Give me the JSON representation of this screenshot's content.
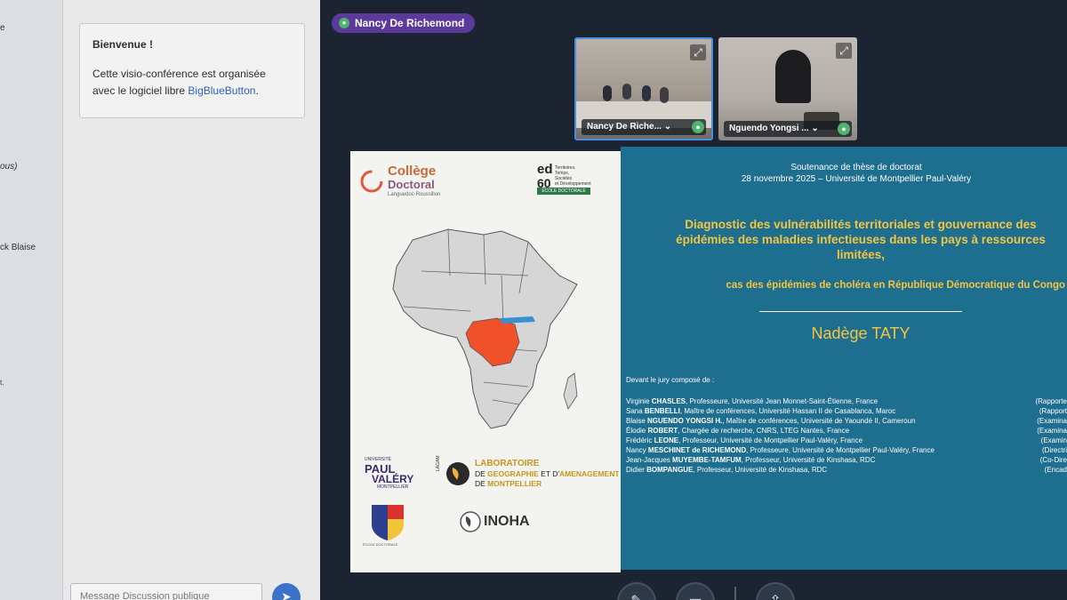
{
  "users": {
    "fragments": [
      "e",
      "ous)",
      "ck Blaise",
      "t."
    ]
  },
  "chat": {
    "welcome_title": "Bienvenue !",
    "welcome_line1": "Cette visio-conférence est organisée",
    "welcome_line2": "avec le logiciel libre",
    "welcome_link": "BigBlueButton",
    "welcome_end": ".",
    "message_placeholder": "Message Discussion publique",
    "send_icon": "send-icon"
  },
  "presenter": {
    "name": "Nancy De Richemond"
  },
  "videos": [
    {
      "name": "Nancy De Riche...",
      "chevron": "⌄"
    },
    {
      "name": "Nguendo Yongsi ...",
      "chevron": "⌄"
    }
  ],
  "slide": {
    "college_line1": "Collège",
    "college_line2": "Doctoral",
    "college_sub": "Languedoc-Roussillon",
    "ed_mark": "ed",
    "ed_num": "60",
    "ed_desc1": "Territoires,",
    "ed_desc2": "Temps,",
    "ed_desc3": "Sociétés",
    "ed_desc4": "et Développement",
    "ed_school": "ÉCOLE DOCTORALE",
    "upv_line1": "PAUL",
    "upv_line2": "VALÉRY",
    "upv_small": "UNIVERSITÉ",
    "upv_bottom": "MONTPELLIER",
    "lab_line1": "LABORATOIRE",
    "lab_line2a": "DE ",
    "lab_line2b": "GEOGRAPHIE",
    "lab_line2c": " ET D'",
    "lab_line2d": "AMENAGEMENT",
    "lab_line3a": "DE ",
    "lab_line3b": "MONTPELLIER",
    "lab_side": "LAGAM",
    "inoha": "INOHA",
    "shield_caption": "ÉCOLE DOCTORALE",
    "header1": "Soutenance de thèse de doctorat",
    "header2": "28 novembre 2025 – Université de Montpellier Paul-Valéry",
    "title1": "Diagnostic des vulnérabilités territoriales et gouvernance des",
    "title2": "épidémies des maladies infectieuses dans les pays à ressources",
    "title3": "limitées,",
    "subtitle": "cas des épidémies de choléra en République Démocratique du Congo",
    "author": "Nadège TATY",
    "jury_intro": "Devant le jury composé de :",
    "jury": [
      {
        "first": "Virginie ",
        "last": "CHASLES",
        "rest": ", Professeure, Université Jean Monnet-Saint-Étienne, France",
        "role": "(Rapporte"
      },
      {
        "first": "Sana ",
        "last": "BENBELLI",
        "rest": ", Maître de conférences, Université Hassan II de Casablanca, Maroc",
        "role": "(Rapport"
      },
      {
        "first": "Blaise ",
        "last": "NGUENDO YONGSI H.",
        "rest": ", Maître de conférences, Université de Yaoundé II, Cameroun",
        "role": "(Examina"
      },
      {
        "first": "Élodie ",
        "last": "ROBERT",
        "rest": ", Chargée de recherche, CNRS, LTEG Nantes, France",
        "role": "(Examina"
      },
      {
        "first": "Frédéric ",
        "last": "LEONE",
        "rest": ", Professeur, Université de Montpellier Paul-Valéry, France",
        "role": "(Examin"
      },
      {
        "first": "Nancy ",
        "last": "MESCHINET de RICHEMOND",
        "rest": ", Professeure, Université de Montpellier Paul-Valéry, France",
        "role": "(Directri"
      },
      {
        "first": "Jean-Jacques ",
        "last": "MUYEMBE-TAMFUM",
        "rest": ", Professeur, Université de Kinshasa, RDC",
        "role": "(Co-Dire"
      },
      {
        "first": "Didier ",
        "last": "BOMPANGUE",
        "rest": ", Professeur, Université de Kinshasa, RDC",
        "role": "(Encad"
      }
    ],
    "colors": {
      "right_bg": "#1e6e8f",
      "title_gold": "#f4c542",
      "drc_red": "#f0502a",
      "map_gray": "#d6d6d6"
    }
  },
  "controls": [
    "mic-off-icon",
    "camera-off-icon",
    "screenshare-icon"
  ]
}
